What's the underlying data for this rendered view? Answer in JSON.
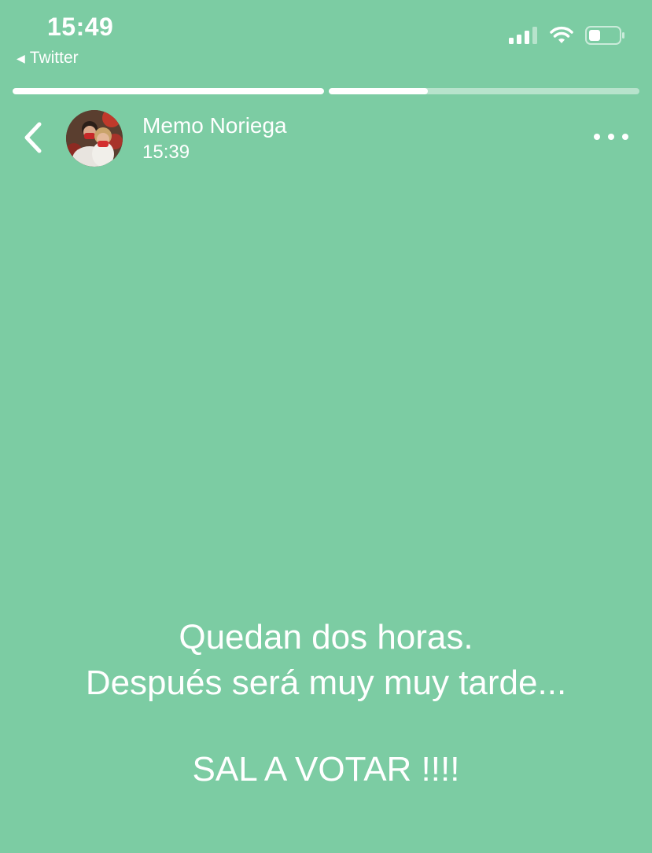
{
  "status_bar": {
    "time": "15:49",
    "back_app": "Twitter",
    "icons": [
      "signal-icon",
      "wifi-icon",
      "battery-icon"
    ]
  },
  "progress": {
    "segments": [
      1.0,
      0.32
    ]
  },
  "header": {
    "user_name": "Memo Noriega",
    "post_time": "15:39"
  },
  "story": {
    "line1": "Quedan dos horas.",
    "line2": "Después será muy muy tarde...",
    "line3": "SAL A VOTAR !!!!"
  },
  "colors": {
    "background": "#7ccca3",
    "text": "#ffffff"
  }
}
